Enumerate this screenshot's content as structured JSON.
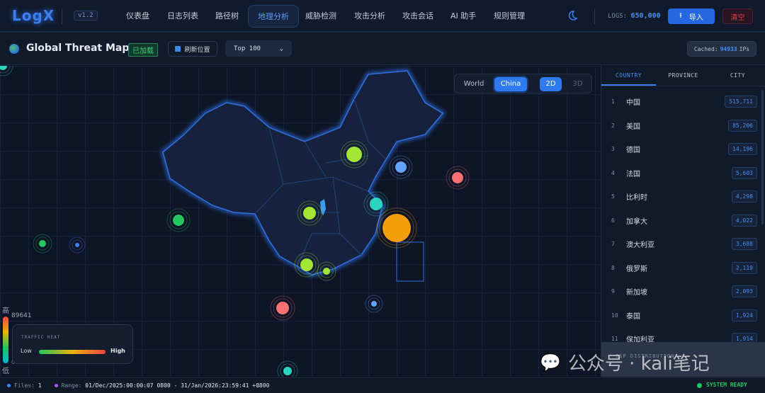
{
  "header": {
    "logo": "LogX",
    "version": "v1.2",
    "nav": [
      "仪表盘",
      "日志列表",
      "路径树",
      "地理分析",
      "威胁检测",
      "攻击分析",
      "攻击会话",
      "AI 助手",
      "规则管理"
    ],
    "active_nav": "地理分析",
    "logs_label": "LOGS:",
    "logs_value": "650,000",
    "import_label": "导入",
    "clear_label": "清空"
  },
  "toolbar": {
    "title": "Global Threat Map",
    "loaded_badge": "已加载",
    "refresh_label": "刷新位置",
    "top_select": "Top 100",
    "cached_label": "Cached:",
    "cached_value": "94933",
    "cached_unit": "IPs"
  },
  "map": {
    "view_world": "World",
    "view_china": "China",
    "mode_2d": "2D",
    "mode_3d": "3D",
    "scale_high": "高",
    "scale_low": "低",
    "scale_max": "89641",
    "scale_min": "0",
    "legend_title": "TRAFFIC HEAT",
    "legend_low": "Low",
    "legend_high": "High",
    "colors": {
      "low": "#22c55e",
      "mid": "#eab308",
      "high": "#ef4444"
    }
  },
  "panel": {
    "tabs": [
      "COUNTRY",
      "PROVINCE",
      "CITY"
    ],
    "active_tab": "COUNTRY",
    "rows": [
      {
        "rank": "1",
        "name": "中国",
        "count": "515,711"
      },
      {
        "rank": "2",
        "name": "美国",
        "count": "85,206"
      },
      {
        "rank": "3",
        "name": "德国",
        "count": "14,196"
      },
      {
        "rank": "4",
        "name": "法国",
        "count": "5,603"
      },
      {
        "rank": "5",
        "name": "比利时",
        "count": "4,298"
      },
      {
        "rank": "6",
        "name": "加拿大",
        "count": "4,022"
      },
      {
        "rank": "7",
        "name": "澳大利亚",
        "count": "3,688"
      },
      {
        "rank": "8",
        "name": "俄罗斯",
        "count": "2,119"
      },
      {
        "rank": "9",
        "name": "新加坡",
        "count": "2,093"
      },
      {
        "rank": "10",
        "name": "泰国",
        "count": "1,924"
      },
      {
        "rank": "11",
        "name": "保加利亚",
        "count": "1,914"
      }
    ],
    "isp_label": "ISP DISTRIBUTION"
  },
  "status": {
    "files_label": "Files:",
    "files_value": "1",
    "range_label": "Range:",
    "range_value": "01/Dec/2025:00:00:07 0800 - 31/Jan/2026:23:59:41 +0800",
    "ready": "SYSTEM READY"
  },
  "watermark": "公众号 · kali笔记"
}
